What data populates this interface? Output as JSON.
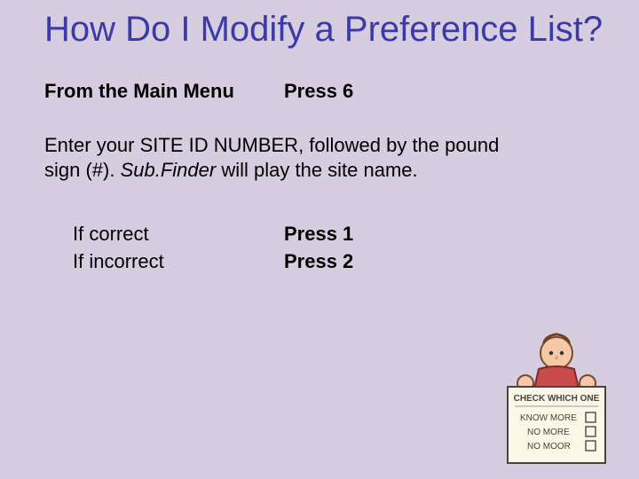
{
  "title": "How Do I Modify a Preference List?",
  "main_row": {
    "left": "From the Main Menu",
    "right": "Press 6"
  },
  "paragraph": {
    "prefix": "Enter your SITE ID NUMBER, followed by the pound sign (#).  ",
    "app": "Sub.Finder",
    "suffix": " will play the site name."
  },
  "options": [
    {
      "label": "If correct",
      "action": "Press 1"
    },
    {
      "label": "If incorrect",
      "action": "Press 2"
    }
  ],
  "illustration": {
    "title": "CHECK WHICH ONE",
    "items": [
      "KNOW MORE",
      "NO MORE",
      "NO MOOR"
    ]
  }
}
